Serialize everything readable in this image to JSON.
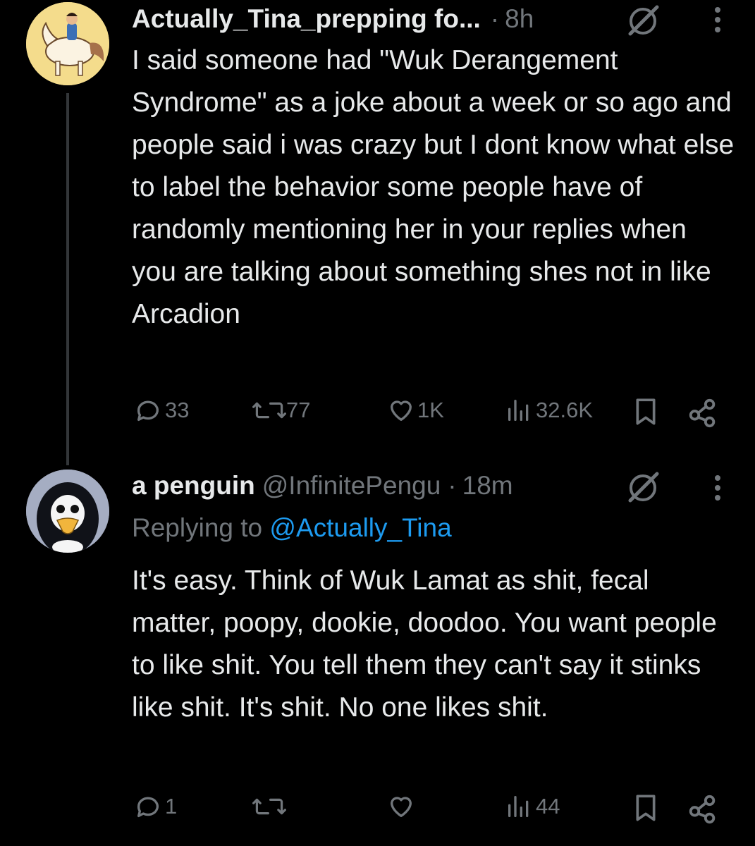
{
  "tweets": [
    {
      "display_name": "Actually_Tina_prepping fo...",
      "handle": "",
      "separator": "·",
      "time": "8h",
      "text": "I said someone had \"Wuk Derangement Syndrome\" as a joke about a week or so ago and people said i was crazy but I dont know what else to label the behavior some people have of randomly mentioning her in your replies when you are talking about something shes not in like Arcadion",
      "actions": {
        "replies": "33",
        "retweets": "77",
        "likes": "1K",
        "views": "32.6K"
      }
    },
    {
      "display_name": "a penguin",
      "handle": "@InfinitePengu",
      "separator": "·",
      "time": "18m",
      "replying_prefix": "Replying to",
      "replying_to": "@Actually_Tina",
      "text": "It's easy. Think of Wuk Lamat as shit, fecal matter, poopy, dookie, doodoo. You want people to like shit. You tell them they can't say it stinks like shit. It's shit. No one likes shit.",
      "actions": {
        "replies": "1",
        "retweets": "",
        "likes": "",
        "views": "44"
      }
    }
  ],
  "icons": [
    "avatar-image",
    "grok-icon",
    "more-icon",
    "reply-icon",
    "retweet-icon",
    "like-icon",
    "views-icon",
    "bookmark-icon",
    "share-icon"
  ],
  "colors": {
    "background": "#000000",
    "text": "#e7e9ea",
    "muted": "#71767b",
    "link": "#1d9bf0",
    "thread_line": "#333639"
  }
}
